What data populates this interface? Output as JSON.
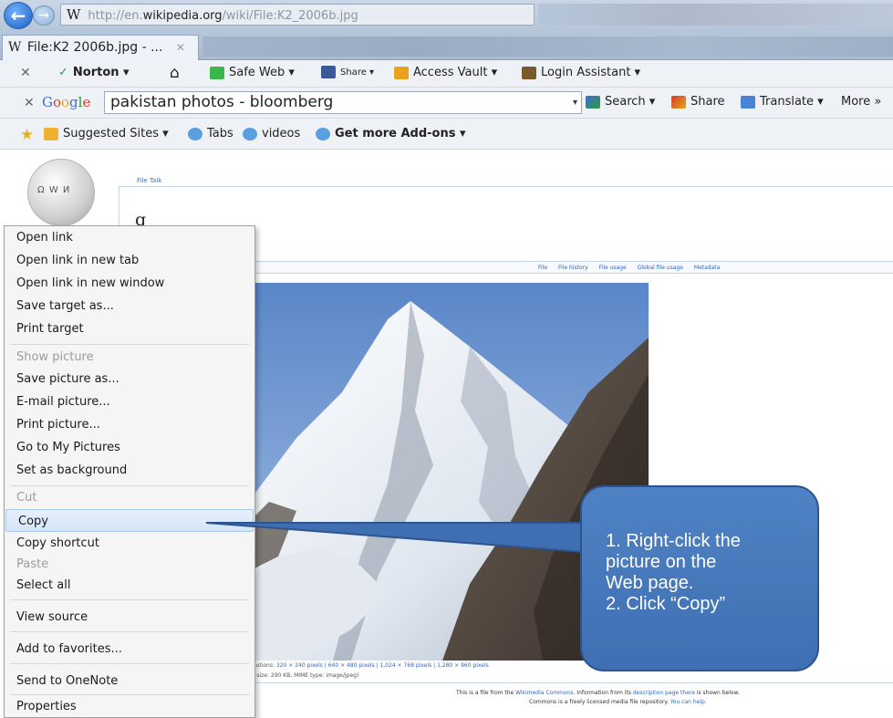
{
  "browser": {
    "address": {
      "prefix": "http://en.",
      "host": "wikipedia.org",
      "path": "/wiki/File:K2_2006b.jpg"
    },
    "wikipedia_glyph": "W",
    "tab": {
      "title": "File:K2 2006b.jpg - ...",
      "close": "✕"
    }
  },
  "norton_toolbar": {
    "close": "✕",
    "norton": "Norton ▾",
    "home": "⌂",
    "safe_web": "Safe Web ▾",
    "share": "Share ▾",
    "access_vault": "Access Vault ▾",
    "login_assistant": "Login Assistant ▾"
  },
  "google_toolbar": {
    "close": "✕",
    "logo": [
      "G",
      "o",
      "o",
      "g",
      "l",
      "e"
    ],
    "query": "pakistan photos - bloomberg",
    "dropdown": "▾",
    "search": "Search ▾",
    "share": "Share",
    "translate": "Translate ▾",
    "more": "More »"
  },
  "favorites_bar": {
    "suggested_sites": "Suggested Sites ▾",
    "tabs": "Tabs",
    "videos": "videos",
    "addons": "Get more Add-ons ▾"
  },
  "page": {
    "tabs_small": "File   Talk",
    "heading": "g",
    "subheading": "ia",
    "file_nav": [
      "File",
      "File history",
      "File usage",
      "Global file usage",
      "Metadata"
    ],
    "resolutions_prefix": "er resolutions: ",
    "resolutions_links": "320 × 240 pixels | 640 × 480 pixels | 1,024 × 768 pixels | 1,280 × 960 pixels",
    "file_size": "els, file size: 290 KB, MIME type: image/jpeg)",
    "commons_line1_prefix": "This is a file from the ",
    "commons_line1_link1": "Wikimedia Commons",
    "commons_line1_mid": ". Information from its ",
    "commons_line1_link2": "description page there",
    "commons_line1_suffix": " is shown below.",
    "commons_line2_prefix": "Commons is a freely licensed media file repository. ",
    "commons_line2_link": "You can help."
  },
  "context_menu": {
    "open_link": "Open link",
    "open_new_tab": "Open link in new tab",
    "open_new_window": "Open link in new window",
    "save_target": "Save target as...",
    "print_target": "Print target",
    "show_picture": "Show picture",
    "save_picture": "Save picture as...",
    "email_picture": "E-mail picture...",
    "print_picture": "Print picture...",
    "go_to_my_pictures": "Go to My Pictures",
    "set_as_background": "Set as background",
    "cut": "Cut",
    "copy": "Copy",
    "copy_shortcut": "Copy shortcut",
    "paste": "Paste",
    "select_all": "Select all",
    "view_source": "View source",
    "add_to_favorites": "Add to favorites...",
    "send_to_onenote": "Send to OneNote",
    "properties": "Properties"
  },
  "callout": {
    "lines": [
      "1. Right-click the",
      "picture on the",
      "Web page.",
      "2. Click “Copy”"
    ]
  },
  "colors": {
    "callout_fill": "#4a7bbf",
    "menu_highlight": "#d4e5f8",
    "link": "#3366bb"
  }
}
